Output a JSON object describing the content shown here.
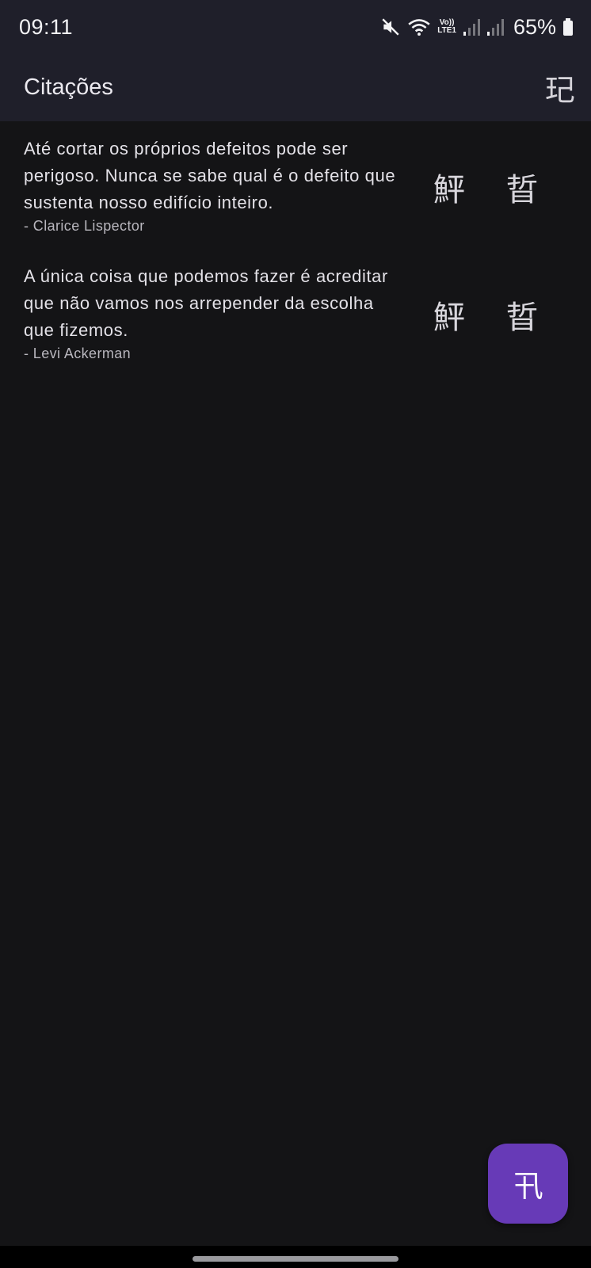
{
  "status_bar": {
    "time": "09:11",
    "network_badge_top": "Vo))",
    "network_badge_bottom": "LTE1",
    "battery_percent": "65%",
    "icons": [
      "mute-icon",
      "wifi-icon",
      "signal-icon",
      "signal-icon",
      "battery-icon"
    ]
  },
  "app_bar": {
    "title": "Citações",
    "action_icon": "玘"
  },
  "quotes": [
    {
      "text": "Até cortar os próprios defeitos pode ser perigoso. Nunca se sabe qual é o defeito que sustenta nosso edifício inteiro.",
      "author": "- Clarice Lispector",
      "action_edit_icon": "鮃",
      "action_delete_icon": "晢"
    },
    {
      "text": "A única coisa que podemos fazer é acreditar que não vamos nos arrepender da escolha que fizemos.",
      "author": "- Levi Ackerman",
      "action_edit_icon": "鮃",
      "action_delete_icon": "晢"
    }
  ],
  "fab": {
    "icon": "卂"
  },
  "colors": {
    "background": "#141416",
    "app_bar": "#1f1f2a",
    "fab": "#673ab7"
  }
}
